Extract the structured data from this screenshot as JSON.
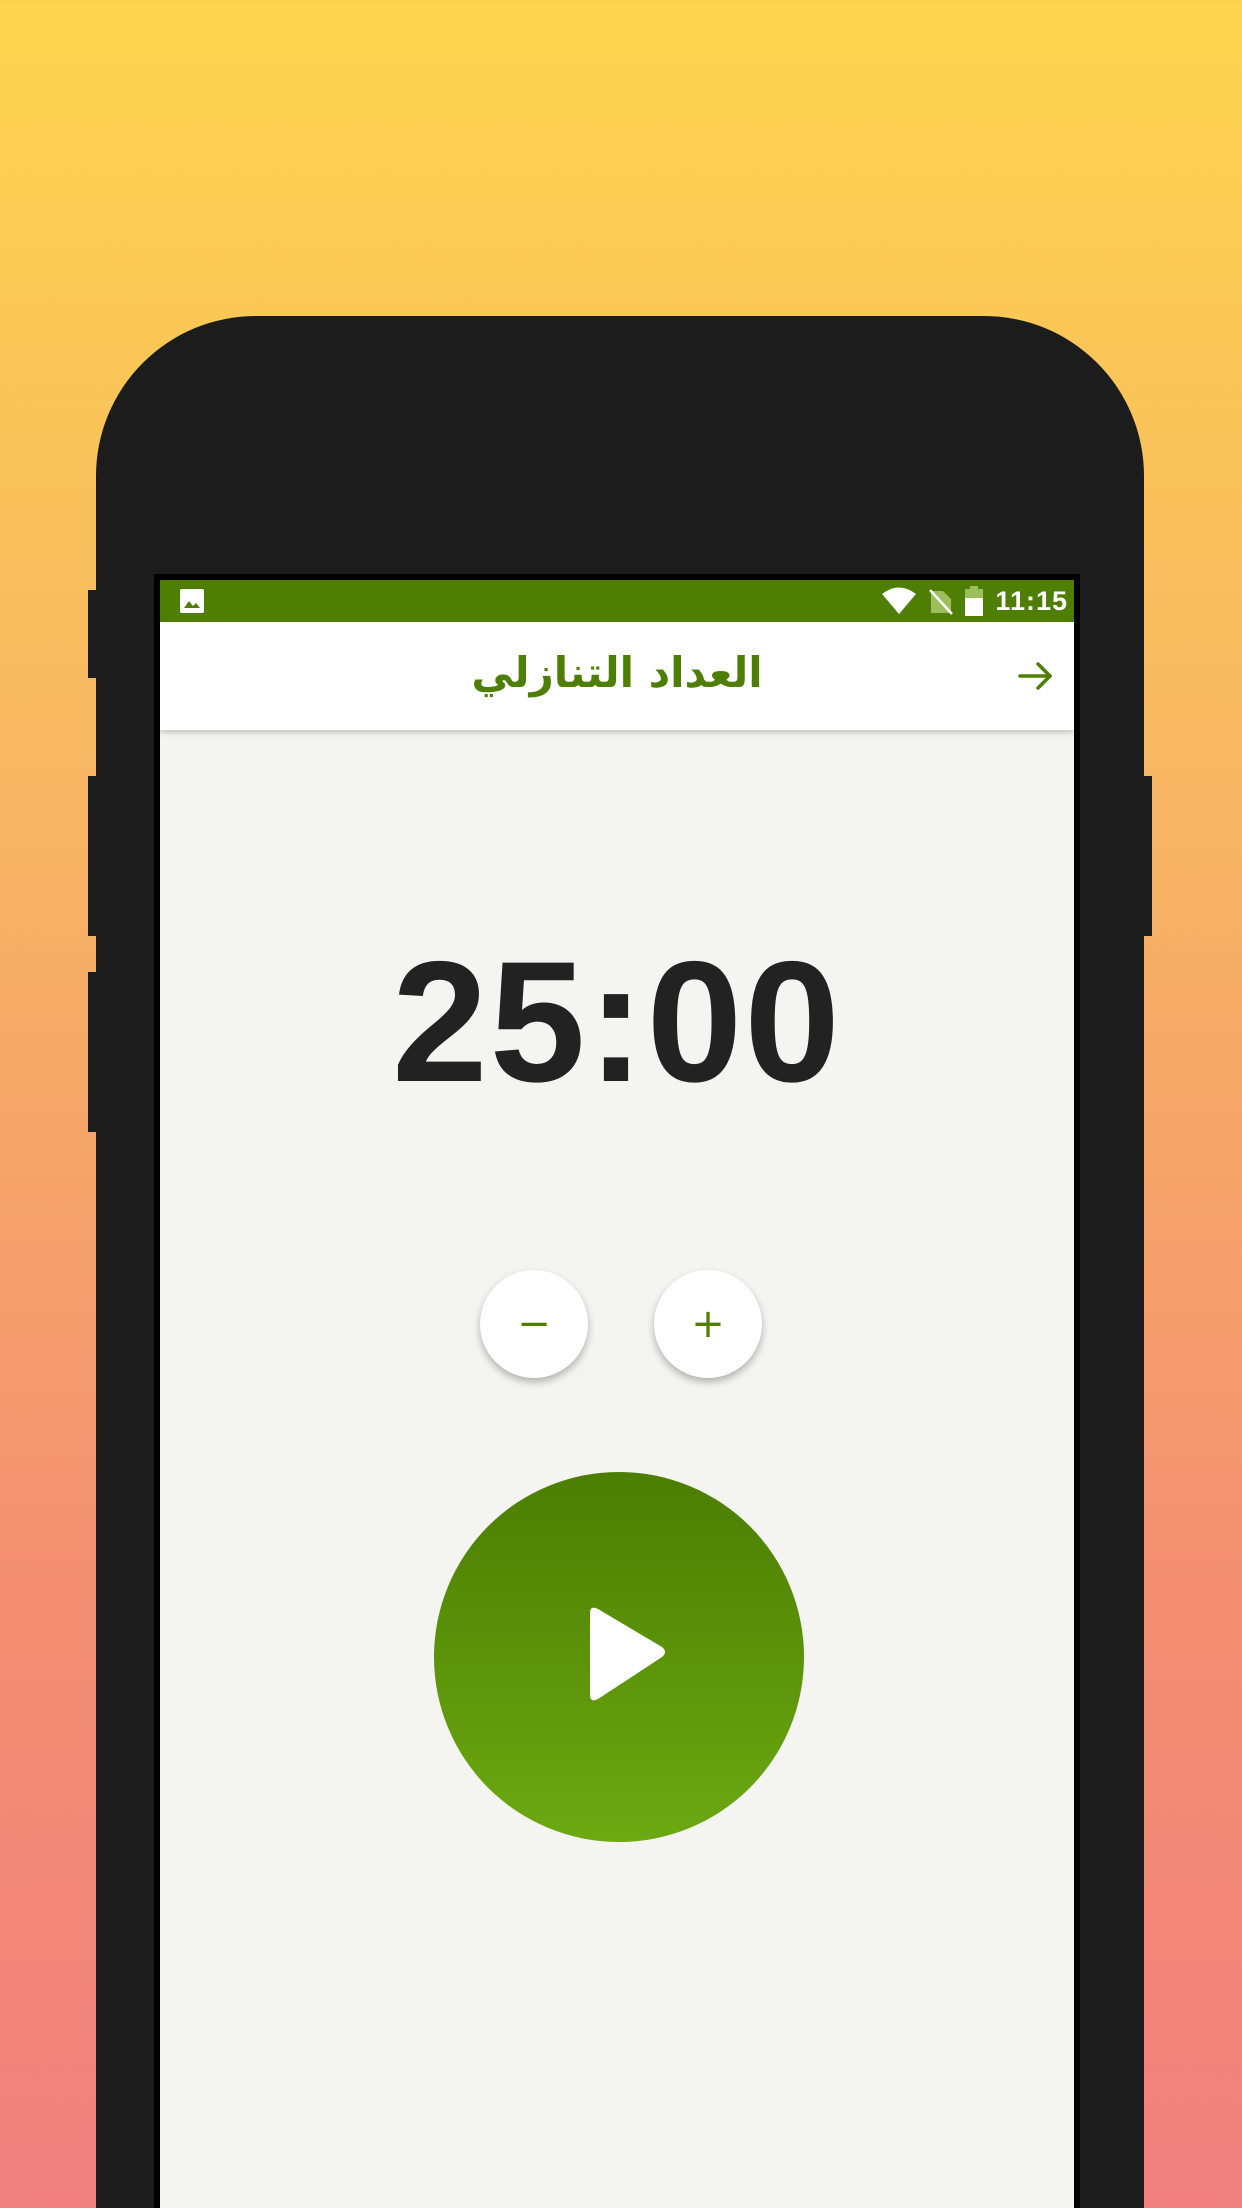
{
  "status_bar": {
    "time": "11:15",
    "left_icon": "image-icon",
    "icons": [
      "wifi-icon",
      "no-sim-icon",
      "battery-icon"
    ]
  },
  "app_bar": {
    "title": "العداد التنازلي",
    "back_icon": "arrow-right-icon"
  },
  "timer": {
    "display": "25:00"
  },
  "controls": {
    "decrement_label": "−",
    "increment_label": "+",
    "play_icon": "play-icon"
  },
  "colors": {
    "primary": "#4e7f04",
    "play_gradient_top": "#4b7d02",
    "play_gradient_bottom": "#6ca912",
    "screen_background": "#f4f4f0",
    "timer_text": "#222222",
    "backdrop_top": "#fdd44e",
    "backdrop_bottom": "#f07f7e"
  }
}
